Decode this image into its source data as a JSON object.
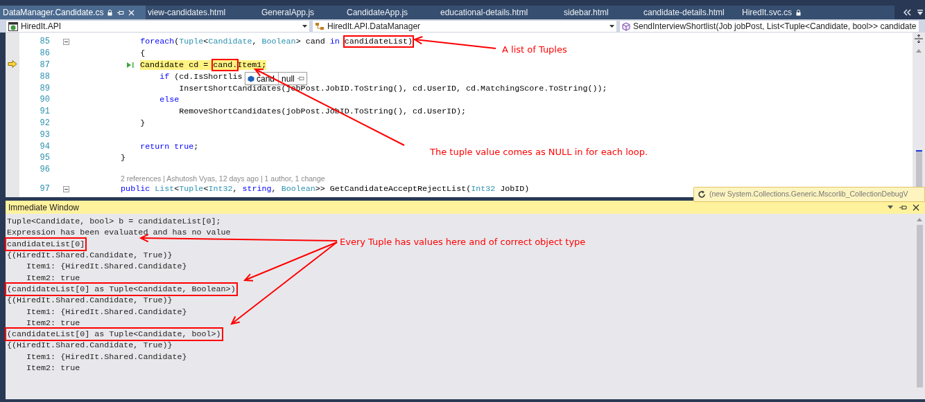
{
  "tabs": [
    {
      "label": "DataManager.Candidate.cs",
      "selected": true,
      "locked": true
    },
    {
      "label": "view-candidates.html",
      "selected": false,
      "locked": false
    },
    {
      "label": "GeneralApp.js",
      "selected": false,
      "locked": false
    },
    {
      "label": "CandidateApp.js",
      "selected": false,
      "locked": false
    },
    {
      "label": "educational-details.html",
      "selected": false,
      "locked": false
    },
    {
      "label": "sidebar.html",
      "selected": false,
      "locked": false
    },
    {
      "label": "candidate-details.html",
      "selected": false,
      "locked": false
    },
    {
      "label": "HiredIt.svc.cs",
      "selected": false,
      "locked": true
    }
  ],
  "nav_bar": {
    "project": "HiredIt.API",
    "type": "HiredIt.API.DataManager",
    "member": "SendInterviewShortlist(Job jobPost, List<Tuple<Candidate, bool>> candidate"
  },
  "editor": {
    "lines": [
      {
        "kind": "code",
        "number": "85",
        "collapsible": true,
        "current": false,
        "tokens": [
          {
            "text": "            foreach",
            "kind": "keyword"
          },
          {
            "text": "(",
            "kind": "plain"
          },
          {
            "text": "Tuple",
            "kind": "type"
          },
          {
            "text": "<",
            "kind": "plain"
          },
          {
            "text": "Candidate",
            "kind": "type"
          },
          {
            "text": ", ",
            "kind": "plain"
          },
          {
            "text": "Boolean",
            "kind": "type"
          },
          {
            "text": "> cand ",
            "kind": "plain"
          },
          {
            "text": "in ",
            "kind": "keyword"
          },
          {
            "text": "candidateList)",
            "kind": "boxed"
          }
        ]
      },
      {
        "kind": "code",
        "number": "86",
        "collapsible": false,
        "current": false,
        "tokens": [
          {
            "text": "            {",
            "kind": "plain"
          }
        ]
      },
      {
        "kind": "code",
        "number": "87",
        "collapsible": false,
        "current": true,
        "tokens": [
          {
            "text": "Candidate cd = ",
            "kind": "plain"
          },
          {
            "text": "cand.",
            "kind": "boxed"
          },
          {
            "text": "Item1;",
            "kind": "plain"
          }
        ]
      },
      {
        "kind": "code",
        "number": "88",
        "collapsible": false,
        "current": false,
        "tokens": [
          {
            "text": "                if",
            "kind": "keyword"
          },
          {
            "text": " (cd.IsShortlis",
            "kind": "plain"
          }
        ]
      },
      {
        "kind": "code",
        "number": "89",
        "collapsible": false,
        "current": false,
        "tokens": [
          {
            "text": "                    InsertShortCandidates(jobPost.JobID.ToString(), cd.UserID, cd.MatchingScore.ToString());",
            "kind": "plain"
          }
        ]
      },
      {
        "kind": "code",
        "number": "90",
        "collapsible": false,
        "current": false,
        "tokens": [
          {
            "text": "                else",
            "kind": "keyword"
          }
        ]
      },
      {
        "kind": "code",
        "number": "91",
        "collapsible": false,
        "current": false,
        "tokens": [
          {
            "text": "                    RemoveShortCandidates(jobPost.JobID.ToString(), cd.UserID);",
            "kind": "plain"
          }
        ]
      },
      {
        "kind": "code",
        "number": "92",
        "collapsible": false,
        "current": false,
        "tokens": [
          {
            "text": "            }",
            "kind": "plain"
          }
        ]
      },
      {
        "kind": "code",
        "number": "93",
        "collapsible": false,
        "current": false
      },
      {
        "kind": "code",
        "number": "94",
        "collapsible": false,
        "current": false,
        "tokens": [
          {
            "text": "            return",
            "kind": "keyword"
          },
          {
            "text": " true",
            "kind": "keyword"
          },
          {
            "text": ";",
            "kind": "plain"
          }
        ]
      },
      {
        "kind": "code",
        "number": "95",
        "collapsible": false,
        "current": false,
        "tokens": [
          {
            "text": "        }",
            "kind": "plain"
          }
        ]
      },
      {
        "kind": "code",
        "number": "96",
        "collapsible": false,
        "current": false
      },
      {
        "kind": "codelens",
        "text": "2 references | Ashutosh Vyas, 12 days ago | 1 author, 1 change"
      },
      {
        "kind": "code",
        "number": "97",
        "collapsible": true,
        "current": false,
        "tokens": [
          {
            "text": "        public",
            "kind": "keyword"
          },
          {
            "text": " List",
            "kind": "type"
          },
          {
            "text": "<",
            "kind": "plain"
          },
          {
            "text": "Tuple",
            "kind": "type"
          },
          {
            "text": "<",
            "kind": "plain"
          },
          {
            "text": "Int32",
            "kind": "type"
          },
          {
            "text": ", ",
            "kind": "plain"
          },
          {
            "text": "string",
            "kind": "keyword"
          },
          {
            "text": ", ",
            "kind": "plain"
          },
          {
            "text": "Boolean",
            "kind": "type"
          },
          {
            "text": ">> GetCandidateAcceptRejectList(",
            "kind": "plain"
          },
          {
            "text": "Int32",
            "kind": "type"
          },
          {
            "text": " JobID)",
            "kind": "plain"
          }
        ]
      }
    ]
  },
  "datatip": {
    "name": "cand",
    "value": "null"
  },
  "tooltip": "(new System.Collections.Generic.Mscorlib_CollectionDebugV",
  "immediate_window": {
    "title": "Immediate Window",
    "lines": [
      {
        "text": "Tuple<Candidate, bool> b = candidateList[0];",
        "boxed": false
      },
      {
        "text": "Expression has been evaluated and has no value",
        "boxed": false
      },
      {
        "text": "candidateList[0]",
        "boxed": true
      },
      {
        "text": "{(HiredIt.Shared.Candidate, True)}",
        "boxed": false
      },
      {
        "text": "    Item1: {HiredIt.Shared.Candidate}",
        "boxed": false
      },
      {
        "text": "    Item2: true",
        "boxed": false
      },
      {
        "text": "(candidateList[0] as Tuple<Candidate, Boolean>)",
        "boxed": true
      },
      {
        "text": "{(HiredIt.Shared.Candidate, True)}",
        "boxed": false
      },
      {
        "text": "    Item1: {HiredIt.Shared.Candidate}",
        "boxed": false
      },
      {
        "text": "    Item2: true",
        "boxed": false
      },
      {
        "text": "(candidateList[0] as Tuple<Candidate, bool>)",
        "boxed": true
      },
      {
        "text": "{(HiredIt.Shared.Candidate, True)}",
        "boxed": false
      },
      {
        "text": "    Item1: {HiredIt.Shared.Candidate}",
        "boxed": false
      },
      {
        "text": "    Item2: true",
        "boxed": false
      }
    ]
  },
  "annotations": [
    {
      "text": "A list of Tuples"
    },
    {
      "text": "The tuple value comes as NULL in for each loop."
    },
    {
      "text": "Every Tuple has values here and of correct object type"
    }
  ]
}
